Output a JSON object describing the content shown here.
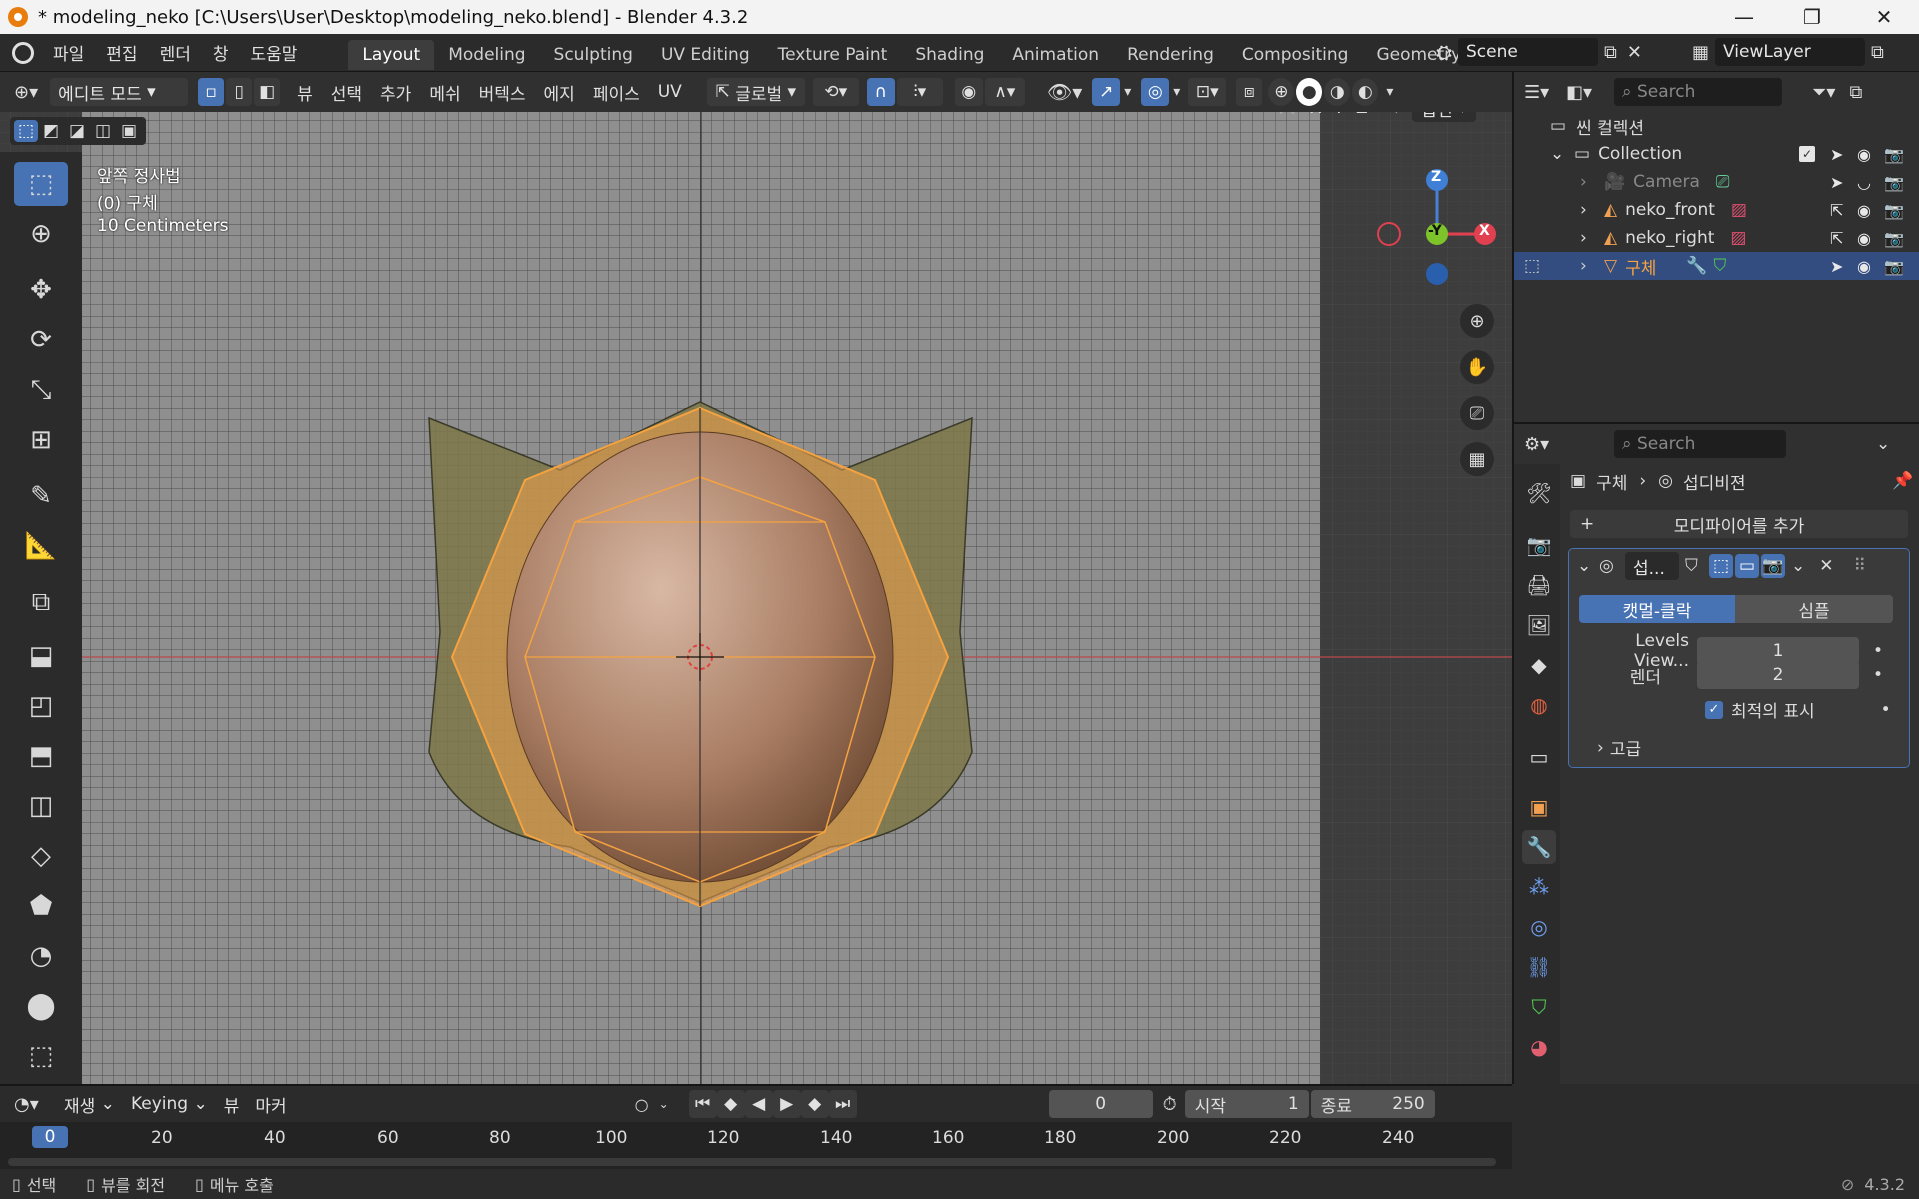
{
  "window": {
    "title": "* modeling_neko [C:\\Users\\User\\Desktop\\modeling_neko.blend] - Blender 4.3.2",
    "minimize": "—",
    "maximize": "❐",
    "close": "✕"
  },
  "menubar": {
    "file": "파일",
    "edit": "편집",
    "render": "렌더",
    "window": "창",
    "help": "도움말",
    "workspaces": [
      "Layout",
      "Modeling",
      "Sculpting",
      "UV Editing",
      "Texture Paint",
      "Shading",
      "Animation",
      "Rendering",
      "Compositing",
      "Geometry Node"
    ],
    "active_workspace": "Layout",
    "scene": "Scene",
    "view_layer": "ViewLayer"
  },
  "header3d": {
    "mode": "에디트 모드",
    "menus": [
      "뷰",
      "선택",
      "추가",
      "메쉬",
      "버텍스",
      "에지",
      "페이스",
      "UV"
    ],
    "transform": "글로벌",
    "options": "옵션",
    "axes": [
      "X",
      "Y",
      "Z"
    ]
  },
  "viewport": {
    "view_name": "앞쪽 정사법",
    "object_label": "(0) 구체",
    "scale": "10 Centimeters",
    "gizmo": {
      "z": "Z",
      "y": "-Y",
      "x": "X"
    }
  },
  "outliner": {
    "search_placeholder": "Search",
    "scene_collection": "씬 컬렉션",
    "collection": "Collection",
    "items": [
      {
        "name": "Camera"
      },
      {
        "name": "neko_front"
      },
      {
        "name": "neko_right"
      },
      {
        "name": "구체"
      }
    ]
  },
  "properties": {
    "search_placeholder": "Search",
    "breadcrumb_object": "구체",
    "breadcrumb_modifier": "섭디비젼",
    "add_modifier": "모디파이어를 추가",
    "modifier_name": "섭...",
    "mode_catmull": "캣멀-클락",
    "mode_simple": "심플",
    "levels_label": "Levels View...",
    "levels_value": "1",
    "render_label": "렌더",
    "render_value": "2",
    "optimal_label": "최적의 표시",
    "advanced": "고급"
  },
  "timeline": {
    "playback": "재생",
    "keying": "Keying",
    "view": "뷰",
    "marker": "마커",
    "current_frame": "0",
    "start_label": "시작",
    "start_value": "1",
    "end_label": "종료",
    "end_value": "250",
    "ruler": [
      "0",
      "20",
      "40",
      "60",
      "80",
      "100",
      "120",
      "140",
      "160",
      "180",
      "200",
      "220",
      "240"
    ]
  },
  "status": {
    "select": "선택",
    "rotate_view": "뷰를 회전",
    "call_menu": "메뉴 호출",
    "version": "4.3.2"
  },
  "colors": {
    "accent": "#4772b3",
    "selection_orange": "#f5a341",
    "header": "#303030",
    "viewport": "#3d3d3d"
  }
}
